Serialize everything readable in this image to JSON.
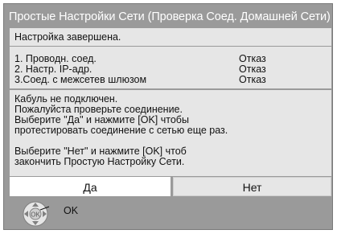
{
  "dialog": {
    "title": "Простые Настройки Сети  (Проверка Соед. Домашней Сети)",
    "status": "Настройка завершена.",
    "results": [
      {
        "label": "1. Проводн. соед.",
        "value": "Отказ"
      },
      {
        "label": "2. Настр. IP-адр.",
        "value": "Отказ"
      },
      {
        "label": "3.Соед. с межсетев шлюзом",
        "value": "Отказ"
      }
    ],
    "message": {
      "line1": "Кабуль не подключен.",
      "line2": "Пожалуйста проверьте соединение.",
      "line3": "Выберите \"Да\" и нажмите [OK] чтобы",
      "line4": "протестировать соединение с сетью еще раз.",
      "line5": "Выберите \"Нет\" и нажмите [OK] чтоб",
      "line6": "закончить Простую Настройку Сети."
    },
    "buttons": {
      "yes_label": "Да",
      "no_label": "Нет"
    },
    "hint": {
      "icon": "remote-dpad-icon",
      "label": "OK"
    }
  },
  "colors": {
    "dialog_bg": "#9a9a9a",
    "panel_bg": "#e6e6e6",
    "selected_button_bg": "#ffffff",
    "title_text": "#ffffff"
  }
}
